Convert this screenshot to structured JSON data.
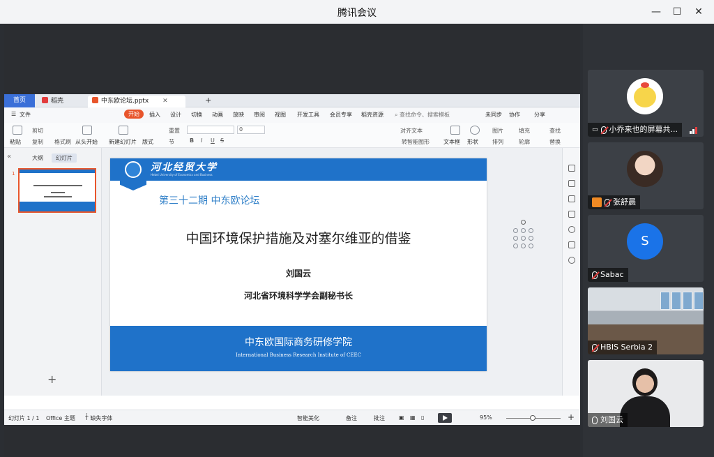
{
  "window": {
    "title": "腾讯会议",
    "minimize": "—",
    "maximize": "☐",
    "close": "✕"
  },
  "ppt": {
    "tabs": {
      "home": "首页",
      "docer": "稻壳",
      "file": "中东欧论坛.pptx"
    },
    "menu": {
      "file": "文件",
      "start": "开始",
      "insert": "插入",
      "design": "设计",
      "transition": "切换",
      "animation": "动画",
      "slideshow": "放映",
      "review": "审阅",
      "view": "视图",
      "devtools": "开发工具",
      "member": "会员专享",
      "docer": "稻壳资源",
      "search": "查找命令、搜索模板",
      "sync": "未同步",
      "collab": "协作",
      "share": "分享"
    },
    "ribbon": {
      "paste": "粘贴",
      "cut": "剪切",
      "copy": "复制",
      "format_painter": "格式刷",
      "from_start": "从头开始",
      "new_slide": "新建幻灯片",
      "layout": "版式",
      "section": "节",
      "reset": "重置",
      "font_size": "0",
      "text_box": "文本框",
      "shape": "形状",
      "picture": "图片",
      "fill": "填充",
      "arrange": "排列",
      "outline": "轮廓",
      "find": "查找",
      "replace": "替换",
      "align_text": "对齐文本",
      "smart_shape": "转智能图形"
    },
    "left_panel": {
      "outline_tab": "大纲",
      "slides_tab": "幻灯片",
      "slide_number": "1",
      "add": "+"
    },
    "slide": {
      "university": "河北经贸大学",
      "university_en": "Hebei University of Economics and Business",
      "issue": "第三十二期  中东欧论坛",
      "title": "中国环境保护措施及对塞尔维亚的借鉴",
      "author": "刘国云",
      "role": "河北省环境科学学会副秘书长",
      "institute": "中东欧国际商务研修学院",
      "institute_en": "International Business Research Institute of CEEC"
    },
    "status": {
      "slide_count": "幻灯片 1 / 1",
      "theme": "Office 主题",
      "missing_font": "缺失字体",
      "smart_beautify": "智能美化",
      "notes": "备注",
      "comments": "批注",
      "zoom": "95%"
    }
  },
  "participants": [
    {
      "name": "小乔来也的屏幕共...",
      "muted": true,
      "kind": "cartoon"
    },
    {
      "name": "张舒晨",
      "muted": true,
      "kind": "photo"
    },
    {
      "name": "Sabac",
      "muted": true,
      "kind": "initial",
      "initial": "S"
    },
    {
      "name": "HBIS Serbia 2",
      "muted": true,
      "kind": "video"
    },
    {
      "name": "刘国云",
      "muted": false,
      "kind": "video"
    }
  ],
  "colors": {
    "accent_blue": "#1f72c9",
    "start_tab": "#e8552c",
    "avatar_blue": "#1a73e8"
  }
}
